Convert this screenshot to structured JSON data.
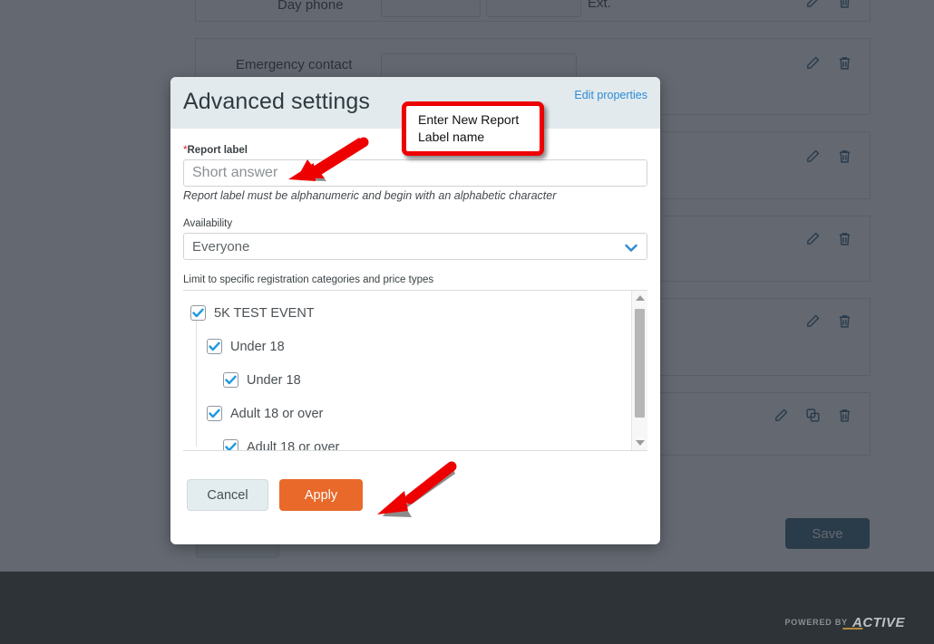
{
  "background": {
    "rows": [
      {
        "label": "Day phone",
        "required": true,
        "ext_label": "Ext.",
        "icons": [
          "pencil-icon",
          "trash-icon"
        ]
      },
      {
        "label": "Emergency contact",
        "required": false,
        "ext_label": "",
        "icons": [
          "pencil-icon",
          "trash-icon"
        ]
      },
      {
        "label": "",
        "required": false,
        "ext_label": "",
        "icons": [
          "pencil-icon",
          "trash-icon"
        ]
      },
      {
        "label": "",
        "required": false,
        "ext_label": "",
        "icons": [
          "pencil-icon",
          "trash-icon"
        ]
      },
      {
        "label": "",
        "required": false,
        "ext_label": "",
        "icons": [
          "pencil-icon",
          "trash-icon"
        ]
      },
      {
        "label": "",
        "required": false,
        "ext_label": "",
        "icons": [
          "pencil-icon",
          "copy-icon",
          "trash-icon"
        ]
      }
    ],
    "save_button": "Save"
  },
  "footer": {
    "powered_by": "POWERED BY",
    "brand": "ACTIVE"
  },
  "modal": {
    "title": "Advanced settings",
    "edit_properties_link": "Edit properties",
    "report_label": {
      "label": "Report label",
      "required_marker": "*",
      "value": "",
      "placeholder": "Short answer",
      "helper": "Report label must be alphanumeric and begin with an alphabetic character"
    },
    "availability": {
      "label": "Availability",
      "selected": "Everyone",
      "options": [
        "Everyone"
      ]
    },
    "limit": {
      "label": "Limit to specific registration categories and price types",
      "tree": [
        {
          "label": "5K TEST EVENT",
          "depth": 0,
          "checked": true
        },
        {
          "label": "Under 18",
          "depth": 1,
          "checked": true
        },
        {
          "label": "Under 18",
          "depth": 2,
          "checked": true
        },
        {
          "label": "Adult 18 or over",
          "depth": 1,
          "checked": true
        },
        {
          "label": "Adult 18 or over",
          "depth": 2,
          "checked": true
        }
      ]
    },
    "cancel_label": "Cancel",
    "apply_label": "Apply"
  },
  "annotations": {
    "callout_line1": "Enter New Report",
    "callout_line2": "Label name",
    "callout_border_color": "#ee0000",
    "arrow_color": "#ee0000"
  },
  "colors": {
    "overlay": "#4f5660",
    "modal_header_bg": "#e2eaed",
    "apply_orange": "#e8692a",
    "link_blue": "#2f8bd6",
    "checkbox_blue": "#1e9ae0",
    "footer_bg": "#2e3338",
    "save_btn_bg": "#2f5a70"
  }
}
